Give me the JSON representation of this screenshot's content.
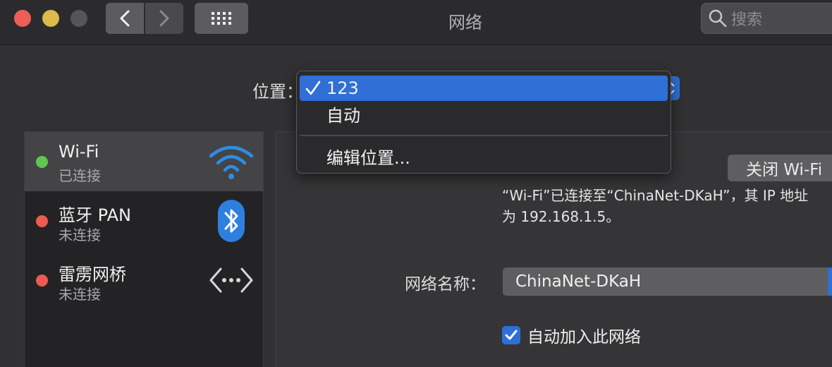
{
  "window": {
    "title": "网络"
  },
  "search": {
    "placeholder": "搜索"
  },
  "location": {
    "label": "位置：",
    "menu_items": [
      {
        "label": "123",
        "selected": true
      },
      {
        "label": "自动",
        "selected": false
      },
      {
        "label": "编辑位置...",
        "selected": false
      }
    ]
  },
  "services": [
    {
      "name": "Wi-Fi",
      "status": "已连接",
      "status_color": "#5fc74d",
      "icon": "wifi-icon",
      "selected": true
    },
    {
      "name": "蓝牙 PAN",
      "status": "未连接",
      "status_color": "#ee5a52",
      "icon": "bluetooth-icon",
      "selected": false
    },
    {
      "name": "雷雳网桥",
      "status": "未连接",
      "status_color": "#ee5a52",
      "icon": "thunderbolt-bridge-icon",
      "selected": false
    }
  ],
  "wifi_panel": {
    "toggle_button": "关闭 Wi-Fi",
    "status_line1": "“Wi-Fi”已连接至“ChinaNet-DKaH”，其 IP 地址",
    "status_line2": "为 192.168.1.5。",
    "network_name_label": "网络名称：",
    "network_name_value": "ChinaNet-DKaH",
    "auto_join_label": "自动加入此网络",
    "auto_join_checked": true
  },
  "colors": {
    "accent": "#2f6fd6",
    "connected": "#5fc74d",
    "disconnected": "#ee5a52"
  }
}
